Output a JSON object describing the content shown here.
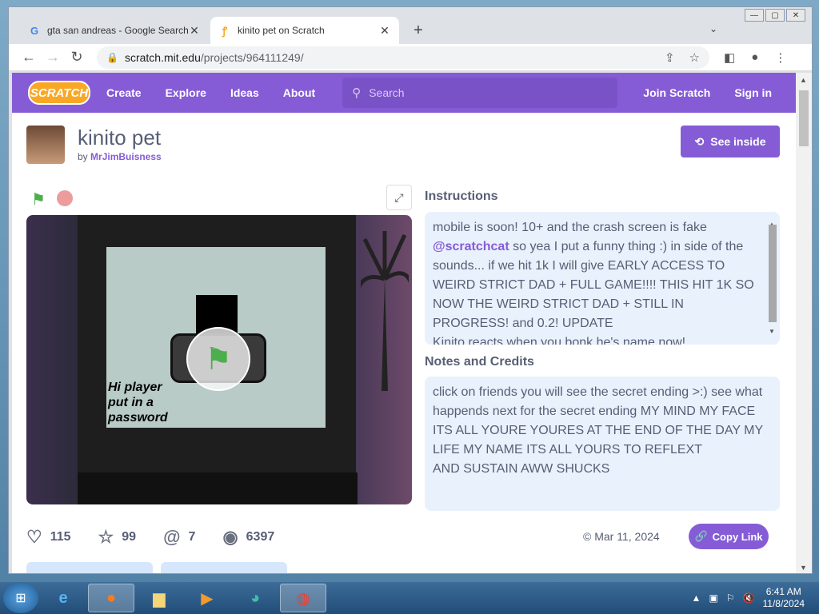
{
  "browser": {
    "tabs": [
      {
        "title": "gta san andreas - Google Search",
        "favicon": "google-g-icon"
      },
      {
        "title": "kinito pet on Scratch",
        "favicon": "scratch-icon"
      }
    ],
    "url": {
      "host": "scratch.mit.edu",
      "path": "/projects/964111249/"
    }
  },
  "nav": {
    "logo": "SCRATCH",
    "links": [
      "Create",
      "Explore",
      "Ideas",
      "About"
    ],
    "search_placeholder": "Search",
    "join": "Join Scratch",
    "signin": "Sign in"
  },
  "project": {
    "title": "kinito pet",
    "by_label": "by",
    "author": "MrJimBuisness",
    "see_inside": "See inside",
    "stage_text": "Hi player\nput in a\npassword"
  },
  "instructions": {
    "heading": "Instructions",
    "line1": "mobile is soon! 10+ and the crash screen is fake",
    "mention": "@scratchcat",
    "line2": " so yea I put a funny thing :) in side of the sounds... if we hit 1k I will give EARLY ACCESS TO WEIRD STRICT DAD + FULL GAME!!!! THIS HIT 1K SO NOW THE WEIRD STRICT DAD + STILL IN PROGRESS! and 0.2! UPDATE",
    "line3": "Kinito reacts when you bonk he's name now!"
  },
  "notes": {
    "heading": "Notes and Credits",
    "text": "click on friends you will see the secret ending >:) see what happends next for the secret ending MY MIND MY FACE ITS ALL YOURE YOURES AT THE END OF THE DAY MY LIFE MY NAME ITS ALL YOURS TO REFLEXT\nAND SUSTAIN AWW SHUCKS"
  },
  "stats": {
    "loves": "115",
    "favorites": "99",
    "remixes": "7",
    "views": "6397",
    "date": "Mar 11, 2024",
    "copy_link": "Copy Link"
  },
  "taskbar": {
    "time": "6:41 AM",
    "date": "11/8/2024"
  },
  "colors": {
    "scratch_purple": "#855cd6",
    "box_blue": "#e9f1fc"
  }
}
